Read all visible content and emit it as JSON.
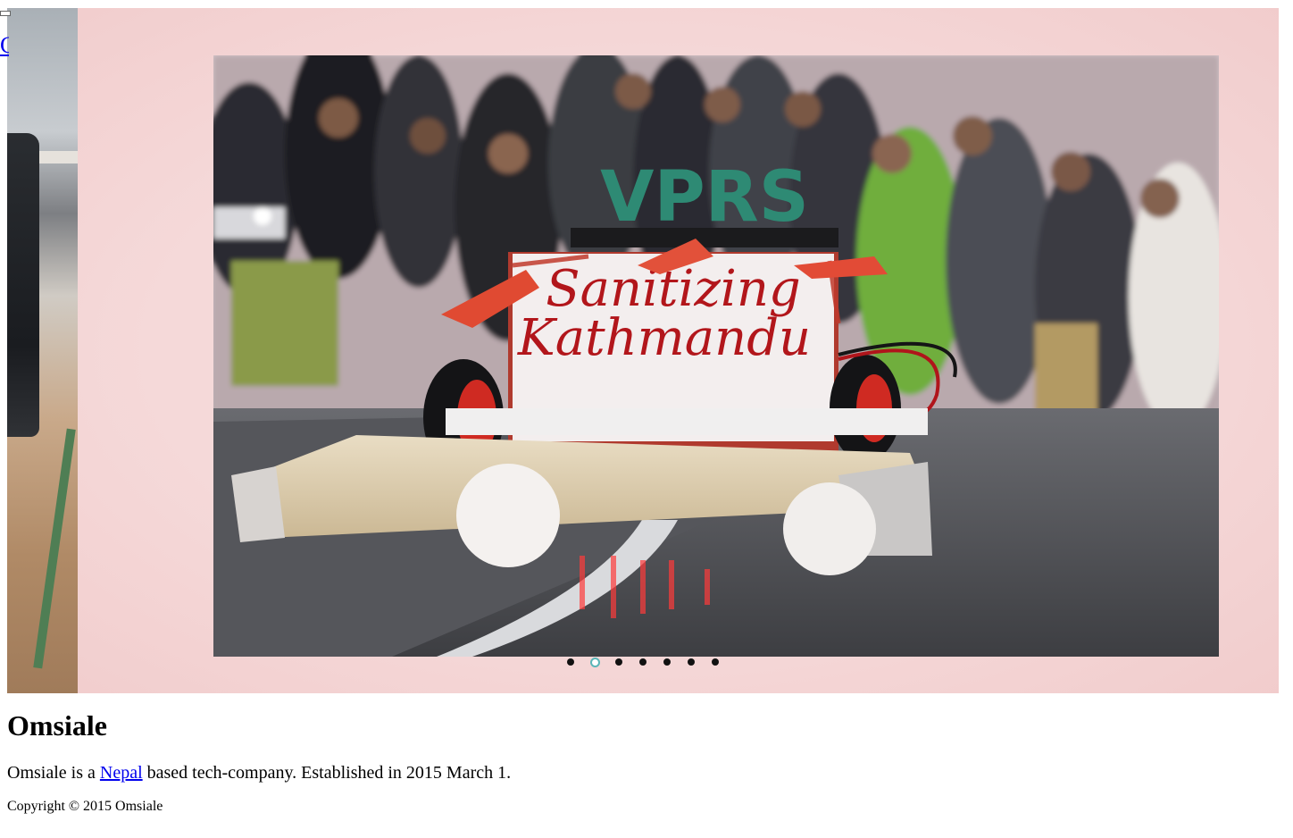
{
  "header": {
    "link_fragment": "C"
  },
  "slider": {
    "dots_count": 7,
    "active_dot_index": 1,
    "current_slide": {
      "sign_top": "VPRS",
      "banner_line_1": "Sanitizing",
      "banner_line_2": "Kathmandu"
    },
    "colors": {
      "frame_tint": "#f5d9d9",
      "active_dot_ring": "#5ab6b8",
      "inactive_dot": "#111111"
    }
  },
  "main": {
    "title": "Omsiale",
    "about_prefix": "Omsiale is a ",
    "about_link": "Nepal",
    "about_suffix": " based tech-company. Established in 2015 March 1."
  },
  "footer": {
    "copyright": "Copyright © 2015 Omsiale"
  }
}
